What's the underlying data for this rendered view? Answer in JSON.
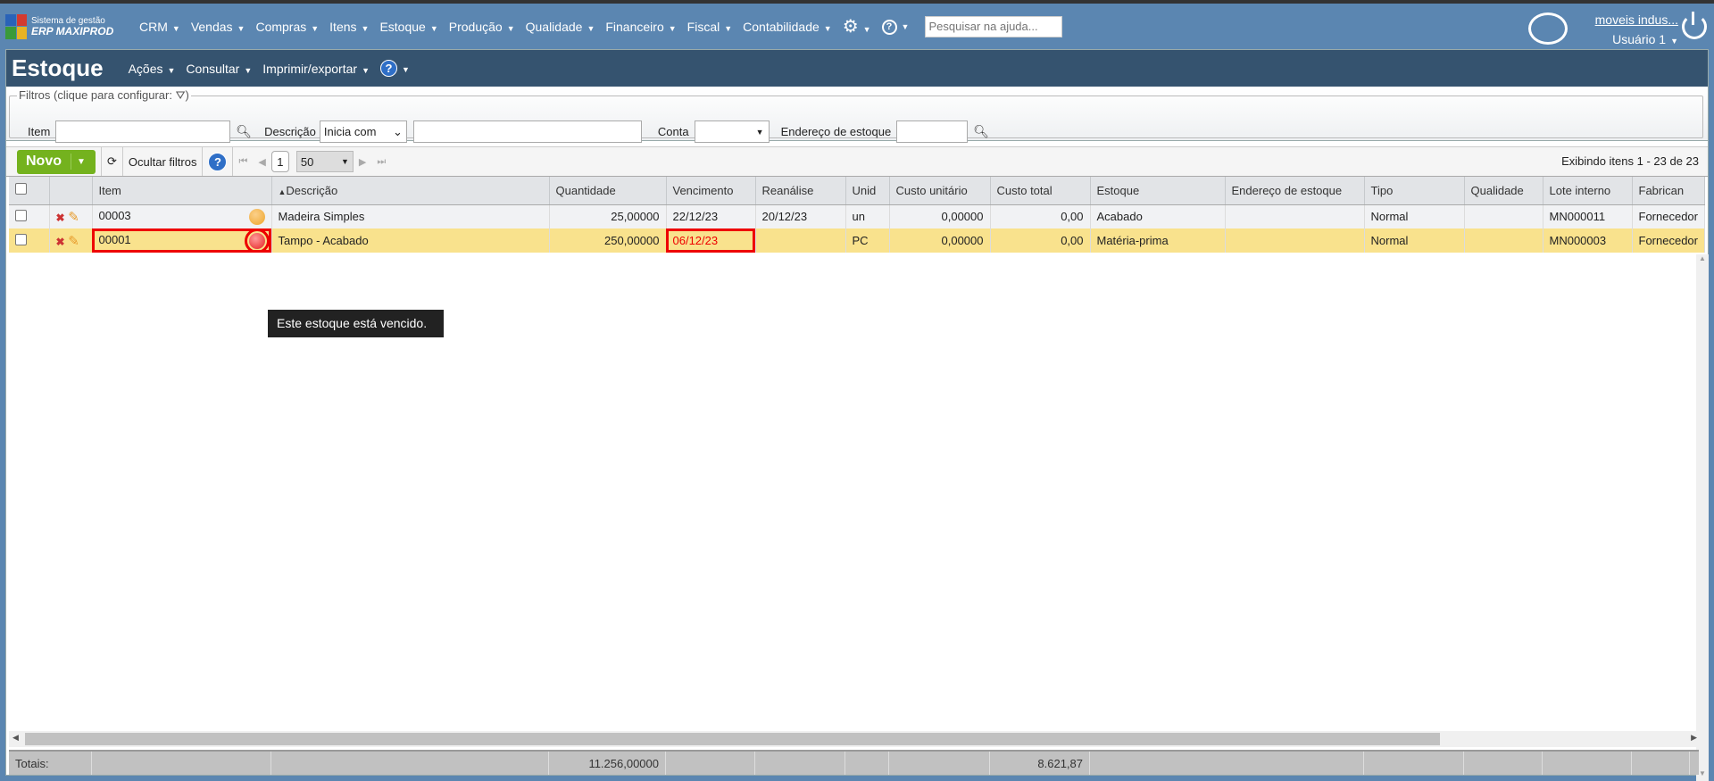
{
  "app": {
    "logo_line1": "Sistema de gestão",
    "logo_line2": "ERP MAXIPROD"
  },
  "nav": {
    "items": [
      "CRM",
      "Vendas",
      "Compras",
      "Itens",
      "Estoque",
      "Produção",
      "Qualidade",
      "Financeiro",
      "Fiscal",
      "Contabilidade"
    ],
    "help_search_placeholder": "Pesquisar na ajuda...",
    "company": "moveis indus...",
    "user": "Usuário 1"
  },
  "page": {
    "title": "Estoque",
    "menus": [
      "Ações",
      "Consultar",
      "Imprimir/exportar"
    ]
  },
  "filters": {
    "legend": "Filtros (clique para configurar:",
    "legend_end": ")",
    "item_label": "Item",
    "item_value": "",
    "desc_label": "Descrição",
    "desc_mode": "Inicia com",
    "desc_value": "",
    "conta_label": "Conta",
    "conta_value": "",
    "endereco_label": "Endereço de estoque",
    "endereco_value": ""
  },
  "toolbar": {
    "new_label": "Novo",
    "hide_filters": "Ocultar filtros",
    "page": "1",
    "page_size": "50",
    "count_text": "Exibindo itens 1 - 23 de 23"
  },
  "table": {
    "columns": [
      "Item",
      "Descrição",
      "Quantidade",
      "Vencimento",
      "Reanálise",
      "Unid",
      "Custo unitário",
      "Custo total",
      "Estoque",
      "Endereço de estoque",
      "Tipo",
      "Qualidade",
      "Lote interno",
      "Fabrican"
    ],
    "rows": [
      {
        "item": "00003",
        "status": "orange",
        "descricao": "Madeira Simples",
        "quantidade": "25,00000",
        "vencimento": "22/12/23",
        "reanalise": "20/12/23",
        "unid": "un",
        "custo_unitario": "0,00000",
        "custo_total": "0,00",
        "estoque": "Acabado",
        "endereco": "",
        "tipo": "Normal",
        "qualidade": "",
        "lote": "MN000011",
        "fabricante": "Fornecedor"
      },
      {
        "item": "00001",
        "status": "red",
        "descricao": "Tampo - Acabado",
        "quantidade": "250,00000",
        "vencimento": "06/12/23",
        "reanalise": "",
        "unid": "PC",
        "custo_unitario": "0,00000",
        "custo_total": "0,00",
        "estoque": "Matéria-prima",
        "endereco": "",
        "tipo": "Normal",
        "qualidade": "",
        "lote": "MN000003",
        "fabricante": "Fornecedor"
      }
    ],
    "tooltip": "Este estoque está vencido.",
    "totals": {
      "label": "Totais:",
      "quantidade": "11.256,00000",
      "custo_total": "8.621,87"
    }
  },
  "colors": {
    "nav": "#5b86b1",
    "header": "#35536f",
    "selected_row": "#f9e28d",
    "expired": "#e00000",
    "new_button": "#74b21e"
  }
}
